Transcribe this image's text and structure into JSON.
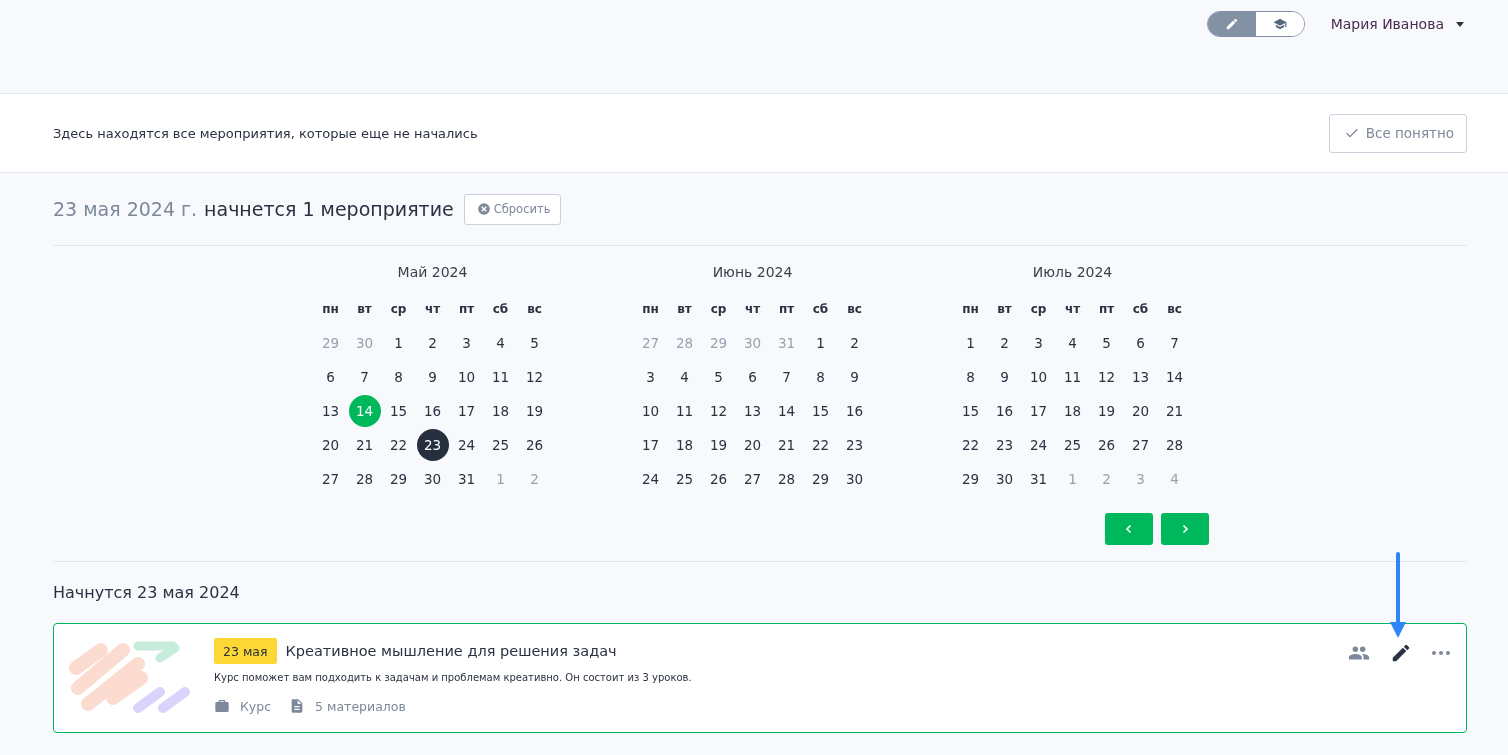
{
  "header": {
    "mode_switch": [
      {
        "kind": "edit",
        "selected": true
      },
      {
        "kind": "learn",
        "selected": false
      }
    ],
    "user_name": "Мария Иванова"
  },
  "banner": {
    "text": "Здесь находятся все мероприятия, которые еще не начались",
    "button": "Все понятно"
  },
  "summary": {
    "date": "23 мая 2024 г.",
    "text": "начнется 1 мероприятие",
    "reset_button": "Сбросить"
  },
  "months": [
    {
      "title": "Май 2024",
      "weekdays": [
        "пн",
        "вт",
        "ср",
        "чт",
        "пт",
        "сб",
        "вс"
      ],
      "weeks": [
        [
          {
            "d": "29",
            "outside": true,
            "today": false,
            "selected": false
          },
          {
            "d": "30",
            "outside": true,
            "today": false,
            "selected": false
          },
          {
            "d": "1",
            "outside": false,
            "today": false,
            "selected": false
          },
          {
            "d": "2",
            "outside": false,
            "today": false,
            "selected": false
          },
          {
            "d": "3",
            "outside": false,
            "today": false,
            "selected": false
          },
          {
            "d": "4",
            "outside": false,
            "today": false,
            "selected": false
          },
          {
            "d": "5",
            "outside": false,
            "today": false,
            "selected": false
          }
        ],
        [
          {
            "d": "6",
            "outside": false,
            "today": false,
            "selected": false
          },
          {
            "d": "7",
            "outside": false,
            "today": false,
            "selected": false
          },
          {
            "d": "8",
            "outside": false,
            "today": false,
            "selected": false
          },
          {
            "d": "9",
            "outside": false,
            "today": false,
            "selected": false
          },
          {
            "d": "10",
            "outside": false,
            "today": false,
            "selected": false
          },
          {
            "d": "11",
            "outside": false,
            "today": false,
            "selected": false
          },
          {
            "d": "12",
            "outside": false,
            "today": false,
            "selected": false
          }
        ],
        [
          {
            "d": "13",
            "outside": false,
            "today": false,
            "selected": false
          },
          {
            "d": "14",
            "outside": false,
            "today": true,
            "selected": false
          },
          {
            "d": "15",
            "outside": false,
            "today": false,
            "selected": false
          },
          {
            "d": "16",
            "outside": false,
            "today": false,
            "selected": false
          },
          {
            "d": "17",
            "outside": false,
            "today": false,
            "selected": false
          },
          {
            "d": "18",
            "outside": false,
            "today": false,
            "selected": false
          },
          {
            "d": "19",
            "outside": false,
            "today": false,
            "selected": false
          }
        ],
        [
          {
            "d": "20",
            "outside": false,
            "today": false,
            "selected": false
          },
          {
            "d": "21",
            "outside": false,
            "today": false,
            "selected": false
          },
          {
            "d": "22",
            "outside": false,
            "today": false,
            "selected": false
          },
          {
            "d": "23",
            "outside": false,
            "today": false,
            "selected": true
          },
          {
            "d": "24",
            "outside": false,
            "today": false,
            "selected": false
          },
          {
            "d": "25",
            "outside": false,
            "today": false,
            "selected": false
          },
          {
            "d": "26",
            "outside": false,
            "today": false,
            "selected": false
          }
        ],
        [
          {
            "d": "27",
            "outside": false,
            "today": false,
            "selected": false
          },
          {
            "d": "28",
            "outside": false,
            "today": false,
            "selected": false
          },
          {
            "d": "29",
            "outside": false,
            "today": false,
            "selected": false
          },
          {
            "d": "30",
            "outside": false,
            "today": false,
            "selected": false
          },
          {
            "d": "31",
            "outside": false,
            "today": false,
            "selected": false
          },
          {
            "d": "1",
            "outside": true,
            "today": false,
            "selected": false
          },
          {
            "d": "2",
            "outside": true,
            "today": false,
            "selected": false
          }
        ]
      ]
    },
    {
      "title": "Июнь 2024",
      "weekdays": [
        "пн",
        "вт",
        "ср",
        "чт",
        "пт",
        "сб",
        "вс"
      ],
      "weeks": [
        [
          {
            "d": "27",
            "outside": true,
            "today": false,
            "selected": false
          },
          {
            "d": "28",
            "outside": true,
            "today": false,
            "selected": false
          },
          {
            "d": "29",
            "outside": true,
            "today": false,
            "selected": false
          },
          {
            "d": "30",
            "outside": true,
            "today": false,
            "selected": false
          },
          {
            "d": "31",
            "outside": true,
            "today": false,
            "selected": false
          },
          {
            "d": "1",
            "outside": false,
            "today": false,
            "selected": false
          },
          {
            "d": "2",
            "outside": false,
            "today": false,
            "selected": false
          }
        ],
        [
          {
            "d": "3",
            "outside": false,
            "today": false,
            "selected": false
          },
          {
            "d": "4",
            "outside": false,
            "today": false,
            "selected": false
          },
          {
            "d": "5",
            "outside": false,
            "today": false,
            "selected": false
          },
          {
            "d": "6",
            "outside": false,
            "today": false,
            "selected": false
          },
          {
            "d": "7",
            "outside": false,
            "today": false,
            "selected": false
          },
          {
            "d": "8",
            "outside": false,
            "today": false,
            "selected": false
          },
          {
            "d": "9",
            "outside": false,
            "today": false,
            "selected": false
          }
        ],
        [
          {
            "d": "10",
            "outside": false,
            "today": false,
            "selected": false
          },
          {
            "d": "11",
            "outside": false,
            "today": false,
            "selected": false
          },
          {
            "d": "12",
            "outside": false,
            "today": false,
            "selected": false
          },
          {
            "d": "13",
            "outside": false,
            "today": false,
            "selected": false
          },
          {
            "d": "14",
            "outside": false,
            "today": false,
            "selected": false
          },
          {
            "d": "15",
            "outside": false,
            "today": false,
            "selected": false
          },
          {
            "d": "16",
            "outside": false,
            "today": false,
            "selected": false
          }
        ],
        [
          {
            "d": "17",
            "outside": false,
            "today": false,
            "selected": false
          },
          {
            "d": "18",
            "outside": false,
            "today": false,
            "selected": false
          },
          {
            "d": "19",
            "outside": false,
            "today": false,
            "selected": false
          },
          {
            "d": "20",
            "outside": false,
            "today": false,
            "selected": false
          },
          {
            "d": "21",
            "outside": false,
            "today": false,
            "selected": false
          },
          {
            "d": "22",
            "outside": false,
            "today": false,
            "selected": false
          },
          {
            "d": "23",
            "outside": false,
            "today": false,
            "selected": false
          }
        ],
        [
          {
            "d": "24",
            "outside": false,
            "today": false,
            "selected": false
          },
          {
            "d": "25",
            "outside": false,
            "today": false,
            "selected": false
          },
          {
            "d": "26",
            "outside": false,
            "today": false,
            "selected": false
          },
          {
            "d": "27",
            "outside": false,
            "today": false,
            "selected": false
          },
          {
            "d": "28",
            "outside": false,
            "today": false,
            "selected": false
          },
          {
            "d": "29",
            "outside": false,
            "today": false,
            "selected": false
          },
          {
            "d": "30",
            "outside": false,
            "today": false,
            "selected": false
          }
        ]
      ]
    },
    {
      "title": "Июль 2024",
      "weekdays": [
        "пн",
        "вт",
        "ср",
        "чт",
        "пт",
        "сб",
        "вс"
      ],
      "weeks": [
        [
          {
            "d": "1",
            "outside": false,
            "today": false,
            "selected": false
          },
          {
            "d": "2",
            "outside": false,
            "today": false,
            "selected": false
          },
          {
            "d": "3",
            "outside": false,
            "today": false,
            "selected": false
          },
          {
            "d": "4",
            "outside": false,
            "today": false,
            "selected": false
          },
          {
            "d": "5",
            "outside": false,
            "today": false,
            "selected": false
          },
          {
            "d": "6",
            "outside": false,
            "today": false,
            "selected": false
          },
          {
            "d": "7",
            "outside": false,
            "today": false,
            "selected": false
          }
        ],
        [
          {
            "d": "8",
            "outside": false,
            "today": false,
            "selected": false
          },
          {
            "d": "9",
            "outside": false,
            "today": false,
            "selected": false
          },
          {
            "d": "10",
            "outside": false,
            "today": false,
            "selected": false
          },
          {
            "d": "11",
            "outside": false,
            "today": false,
            "selected": false
          },
          {
            "d": "12",
            "outside": false,
            "today": false,
            "selected": false
          },
          {
            "d": "13",
            "outside": false,
            "today": false,
            "selected": false
          },
          {
            "d": "14",
            "outside": false,
            "today": false,
            "selected": false
          }
        ],
        [
          {
            "d": "15",
            "outside": false,
            "today": false,
            "selected": false
          },
          {
            "d": "16",
            "outside": false,
            "today": false,
            "selected": false
          },
          {
            "d": "17",
            "outside": false,
            "today": false,
            "selected": false
          },
          {
            "d": "18",
            "outside": false,
            "today": false,
            "selected": false
          },
          {
            "d": "19",
            "outside": false,
            "today": false,
            "selected": false
          },
          {
            "d": "20",
            "outside": false,
            "today": false,
            "selected": false
          },
          {
            "d": "21",
            "outside": false,
            "today": false,
            "selected": false
          }
        ],
        [
          {
            "d": "22",
            "outside": false,
            "today": false,
            "selected": false
          },
          {
            "d": "23",
            "outside": false,
            "today": false,
            "selected": false
          },
          {
            "d": "24",
            "outside": false,
            "today": false,
            "selected": false
          },
          {
            "d": "25",
            "outside": false,
            "today": false,
            "selected": false
          },
          {
            "d": "26",
            "outside": false,
            "today": false,
            "selected": false
          },
          {
            "d": "27",
            "outside": false,
            "today": false,
            "selected": false
          },
          {
            "d": "28",
            "outside": false,
            "today": false,
            "selected": false
          }
        ],
        [
          {
            "d": "29",
            "outside": false,
            "today": false,
            "selected": false
          },
          {
            "d": "30",
            "outside": false,
            "today": false,
            "selected": false
          },
          {
            "d": "31",
            "outside": false,
            "today": false,
            "selected": false
          },
          {
            "d": "1",
            "outside": true,
            "today": false,
            "selected": false
          },
          {
            "d": "2",
            "outside": true,
            "today": false,
            "selected": false
          },
          {
            "d": "3",
            "outside": true,
            "today": false,
            "selected": false
          },
          {
            "d": "4",
            "outside": true,
            "today": false,
            "selected": false
          }
        ]
      ]
    }
  ],
  "events_heading": "Начнутся 23 мая 2024",
  "events": [
    {
      "date_badge": "23 мая",
      "title": "Креативное мышление для решения задач",
      "description": "Курс поможет вам подходить к задачам и проблемам креативно. Он состоит из 3 уроков.",
      "meta": [
        {
          "kind": "type",
          "text": "Курс"
        },
        {
          "kind": "materials",
          "text": "5 материалов"
        }
      ]
    }
  ]
}
